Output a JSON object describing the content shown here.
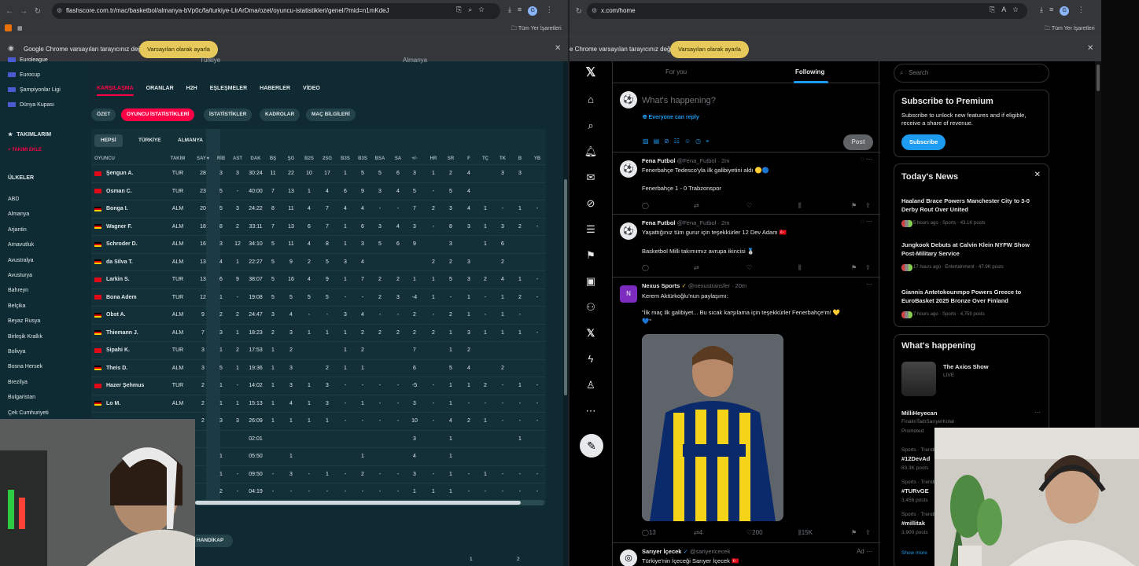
{
  "left_browser": {
    "url": "flashscore.com.tr/mac/basketbol/almanya-bVp0c/fa/turkiye-LlrArDma/ozet/oyuncu-istatistikleri/genel/?mid=n1mKdeJ",
    "bookmarks_label": "Tüm Yer İşaretleri",
    "infobar_text": "Google Chrome varsayılan tarayıcınız değil",
    "infobar_button": "Varsayılan olarak ayarla",
    "avatar_letter": "G"
  },
  "right_browser": {
    "url": "x.com/home",
    "bookmarks_label": "Tüm Yer İşaretleri",
    "infobar_text": "e Chrome varsayılan tarayıcınız değil",
    "infobar_button": "Varsayılan olarak ayarla",
    "avatar_letter": "G"
  },
  "flashscore": {
    "sidebar_top": [
      "Euroleague",
      "Eurocup",
      "Şampiyonlar Ligi",
      "Dünya Kupası"
    ],
    "my_teams_heading": "TAKIMLARIM",
    "add_team": "TAKIMI EKLE",
    "countries_heading": "ÜLKELER",
    "countries": [
      "ABD",
      "Almanya",
      "Arjantin",
      "Arnavutluk",
      "Avustralya",
      "Avusturya",
      "Bahreyn",
      "Belçika",
      "Beyaz Rusya",
      "Birleşik Krallık",
      "Bolivya",
      "Bosna Hersek",
      "Brezilya",
      "Bulgaristan",
      "Çek Cumhuriyeti"
    ],
    "team_home": "Türkiye",
    "team_away": "Almanya",
    "main_tabs": [
      "KARŞILAŞMA",
      "ORANLAR",
      "H2H",
      "EŞLEŞMELER",
      "HABERLER",
      "VİDEO"
    ],
    "sub_tabs": [
      "ÖZET",
      "OYUNCU İSTATİSTİKLERİ",
      "İSTATİSTİKLER",
      "KADROLAR",
      "MAÇ BİLGİLERİ"
    ],
    "filters": [
      "HEPSİ",
      "TÜRKİYE",
      "ALMANYA"
    ],
    "columns": [
      "OYUNCU",
      "TAKIM",
      "SAY",
      "RİB",
      "AST",
      "DAK",
      "BŞ",
      "ŞG",
      "B2S",
      "2SG",
      "B3S",
      "B3S",
      "BSA",
      "SA",
      "+/-",
      "HR",
      "SR",
      "F",
      "TÇ",
      "TK",
      "B",
      "YB"
    ],
    "sort_indicator": "▾",
    "players": [
      {
        "name": "Şengun A.",
        "team": "TUR",
        "flag": "tr",
        "stats": [
          "28",
          "3",
          "3",
          "30:24",
          "11",
          "22",
          "10",
          "17",
          "1",
          "5",
          "5",
          "6",
          "3",
          "1",
          "2",
          "4",
          "",
          "3",
          "3",
          ""
        ]
      },
      {
        "name": "Osman C.",
        "team": "TUR",
        "flag": "tr",
        "stats": [
          "23",
          "5",
          "-",
          "40:00",
          "7",
          "13",
          "1",
          "4",
          "6",
          "9",
          "3",
          "4",
          "5",
          "-",
          "5",
          "4",
          "",
          "",
          "",
          ""
        ]
      },
      {
        "name": "Bonga I.",
        "team": "ALM",
        "flag": "de",
        "stats": [
          "20",
          "5",
          "3",
          "24:22",
          "8",
          "11",
          "4",
          "7",
          "4",
          "4",
          "-",
          "-",
          "7",
          "2",
          "3",
          "4",
          "1",
          "-",
          "1",
          "-"
        ]
      },
      {
        "name": "Wagner F.",
        "team": "ALM",
        "flag": "de",
        "stats": [
          "18",
          "8",
          "2",
          "33:11",
          "7",
          "13",
          "6",
          "7",
          "1",
          "6",
          "3",
          "4",
          "3",
          "-",
          "8",
          "3",
          "1",
          "3",
          "2",
          "-"
        ]
      },
      {
        "name": "Schroder D.",
        "team": "ALM",
        "flag": "de",
        "stats": [
          "16",
          "3",
          "12",
          "34:10",
          "5",
          "11",
          "4",
          "8",
          "1",
          "3",
          "5",
          "6",
          "9",
          "",
          "3",
          "",
          "1",
          "6",
          "",
          ""
        ]
      },
      {
        "name": "da Silva T.",
        "team": "ALM",
        "flag": "de",
        "stats": [
          "13",
          "4",
          "1",
          "22:27",
          "5",
          "9",
          "2",
          "5",
          "3",
          "4",
          "",
          "",
          "",
          "2",
          "2",
          "3",
          "",
          "2",
          "",
          ""
        ]
      },
      {
        "name": "Larkin S.",
        "team": "TUR",
        "flag": "tr",
        "stats": [
          "13",
          "6",
          "9",
          "38:07",
          "5",
          "16",
          "4",
          "9",
          "1",
          "7",
          "2",
          "2",
          "1",
          "1",
          "5",
          "3",
          "2",
          "4",
          "1",
          "-"
        ]
      },
      {
        "name": "Bona Adem",
        "team": "TUR",
        "flag": "tr",
        "stats": [
          "12",
          "1",
          "-",
          "19:08",
          "5",
          "5",
          "5",
          "5",
          "-",
          "-",
          "2",
          "3",
          "-4",
          "1",
          "-",
          "1",
          "-",
          "1",
          "2",
          "-"
        ]
      },
      {
        "name": "Obst A.",
        "team": "ALM",
        "flag": "de",
        "stats": [
          "9",
          "2",
          "2",
          "24:47",
          "3",
          "4",
          "-",
          "-",
          "3",
          "4",
          "-",
          "-",
          "2",
          "-",
          "2",
          "1",
          "-",
          "1",
          "-",
          ""
        ]
      },
      {
        "name": "Thiemann J.",
        "team": "ALM",
        "flag": "de",
        "stats": [
          "7",
          "3",
          "1",
          "18:23",
          "2",
          "3",
          "1",
          "1",
          "1",
          "2",
          "2",
          "2",
          "2",
          "2",
          "1",
          "3",
          "1",
          "1",
          "1",
          "-"
        ]
      },
      {
        "name": "Sipahi K.",
        "team": "TUR",
        "flag": "tr",
        "stats": [
          "3",
          "1",
          "2",
          "17:53",
          "1",
          "2",
          "",
          "",
          "1",
          "2",
          "",
          "",
          "7",
          "",
          "1",
          "2",
          "",
          "",
          "",
          ""
        ]
      },
      {
        "name": "Theis D.",
        "team": "ALM",
        "flag": "de",
        "stats": [
          "3",
          "5",
          "1",
          "19:36",
          "1",
          "3",
          "",
          "2",
          "1",
          "1",
          "",
          "",
          "6",
          "",
          "5",
          "4",
          "",
          "2",
          "",
          ""
        ]
      },
      {
        "name": "Hazer Şehmus",
        "team": "TUR",
        "flag": "tr",
        "stats": [
          "2",
          "1",
          "-",
          "14:02",
          "1",
          "3",
          "1",
          "3",
          "-",
          "-",
          "-",
          "-",
          "-5",
          "-",
          "1",
          "1",
          "2",
          "-",
          "1",
          "-"
        ]
      },
      {
        "name": "Lo M.",
        "team": "ALM",
        "flag": "de",
        "stats": [
          "2",
          "1",
          "1",
          "15:13",
          "1",
          "4",
          "1",
          "3",
          "-",
          "1",
          "-",
          "-",
          "3",
          "-",
          "1",
          "-",
          "-",
          "-",
          "-",
          "-"
        ]
      },
      {
        "name": "",
        "team": "",
        "flag": "",
        "stats": [
          "2",
          "3",
          "3",
          "26:09",
          "1",
          "1",
          "1",
          "1",
          "-",
          "-",
          "-",
          "-",
          "10",
          "-",
          "4",
          "2",
          "1",
          "-",
          "-",
          "-"
        ]
      },
      {
        "name": "",
        "team": "",
        "flag": "",
        "stats": [
          "",
          "",
          "",
          "02:01",
          "",
          "",
          "",
          "",
          "",
          "",
          "",
          "",
          "3",
          "",
          "1",
          "",
          "",
          "",
          "1",
          ""
        ]
      },
      {
        "name": "",
        "team": "",
        "flag": "",
        "stats": [
          "",
          "1",
          "",
          "05:50",
          "",
          "1",
          "",
          "",
          "",
          "1",
          "",
          "",
          "4",
          "",
          "1",
          "",
          "",
          "",
          "",
          ""
        ]
      },
      {
        "name": "",
        "team": "",
        "flag": "",
        "stats": [
          "",
          "1",
          "-",
          "09:50",
          "-",
          "3",
          "-",
          "1",
          "-",
          "2",
          "-",
          "-",
          "3",
          "-",
          "1",
          "-",
          "1",
          "-",
          "-",
          "-"
        ]
      },
      {
        "name": "",
        "team": "",
        "flag": "",
        "stats": [
          "",
          "2",
          "-",
          "04:19",
          "-",
          "-",
          "-",
          "-",
          "-",
          "-",
          "-",
          "-",
          "1",
          "1",
          "1",
          "-",
          "-",
          "-",
          "-",
          "-"
        ]
      }
    ],
    "handicap_label": "YA HANDİKAP",
    "bottom_nums": [
      "1",
      "2"
    ]
  },
  "x": {
    "tabs": [
      "For you",
      "Following"
    ],
    "compose_placeholder": "What's happening?",
    "everyone_can_reply": "Everyone can reply",
    "post_button": "Post",
    "tweets": [
      {
        "name": "Fena Futbol",
        "handle": "@Fena_Futbol",
        "time": "· 2m",
        "lines": [
          "Fenerbahçe Tedesco'yla ilk galibiyetini aldı 🟡🔵",
          "",
          "Fenerbahçe 1 - 0 Trabzonspor"
        ]
      },
      {
        "name": "Fena Futbol",
        "handle": "@Fena_Futbol",
        "time": "· 2m",
        "lines": [
          "Yaşattığınız tüm gurur için teşekkürler 12 Dev Adam 🇹🇷",
          "",
          "Basketbol Milli takımımız avrupa ikincisi 🥈"
        ]
      },
      {
        "name": "Nexus Sports",
        "handle": "@nexustransfer",
        "time": "· 20m",
        "lines": [
          "Kerem Aktürkoğlu'nun paylaşımı:",
          "",
          "\"İlk maç ilk galibiyet... Bu sıcak karşılama için teşekkürler Fenerbahçe'm! 💛",
          "💙\""
        ],
        "stats": {
          "replies": "13",
          "reposts": "4",
          "likes": "200",
          "views": "15K"
        }
      },
      {
        "name": "Sarıyer İçecek",
        "handle": "@sariyericecek",
        "time": "",
        "ad": "Ad",
        "lines": [
          "Türkiye'nin İçeceği Sarıyer İçecek 🇹🇷"
        ]
      }
    ],
    "search_placeholder": "Search",
    "premium": {
      "title": "Subscribe to Premium",
      "text": "Subscribe to unlock new features and if eligible, receive a share of revenue.",
      "button": "Subscribe"
    },
    "news": {
      "title": "Today's News",
      "items": [
        {
          "title": "Haaland Brace Powers Manchester City to 3-0 Derby Rout Over United",
          "meta": "5 hours ago · Sports · 43.1K posts"
        },
        {
          "title": "Jungkook Debuts at Calvin Klein NYFW Show Post-Military Service",
          "meta": "17 hours ago · Entertainment · 47.9K posts"
        },
        {
          "title": "Giannis Antetokounmpo Powers Greece to EuroBasket 2025 Bronze Over Finland",
          "meta": "7 hours ago · Sports · 4,759 posts"
        }
      ]
    },
    "happening": {
      "title": "What's happening",
      "event_title": "The Axios Show",
      "event_status": "LIVE",
      "trends": [
        {
          "name": "MilliHeyecan",
          "meta": "FinalinTadıSarıyerKolal"
        },
        {
          "name": "Promoted",
          "meta": ""
        },
        {
          "name": "#12DevAd",
          "meta": "Sports · Trending"
        },
        {
          "name": "#TURvGE",
          "meta": "Sports · Trending"
        },
        {
          "name": "#millitak",
          "meta": "Sports · Trending"
        }
      ],
      "trend_posts": [
        "83.3K posts",
        "3,456 posts",
        "3,900 posts"
      ],
      "show_more": "Show more"
    }
  },
  "colors": {
    "flashscore_bg": "#0f2a33",
    "flashscore_accent": "#ff0046",
    "x_blue": "#1d9bf0",
    "chrome_bar": "#35363a",
    "infobar_button": "#e7c95b"
  }
}
